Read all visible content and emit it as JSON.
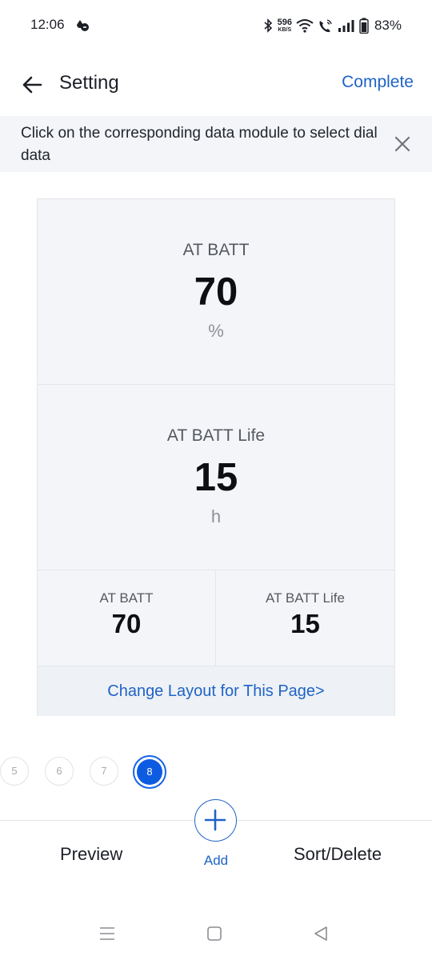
{
  "status_bar": {
    "time": "12:06",
    "net_speed_value": "596",
    "net_speed_unit": "KB/S",
    "battery_percent": "83%",
    "icons": [
      "dnd-icon",
      "bluetooth-icon",
      "wifi-icon",
      "wifi-calling-icon",
      "signal-icon",
      "battery-icon"
    ]
  },
  "header": {
    "title": "Setting",
    "complete_label": "Complete"
  },
  "hint": {
    "text": "Click on the corresponding data module to select dial data"
  },
  "dial": {
    "modules": [
      {
        "label": "AT BATT",
        "value": "70",
        "unit": "%"
      },
      {
        "label": "AT BATT Life",
        "value": "15",
        "unit": "h"
      },
      {
        "label": "AT BATT",
        "value": "70"
      },
      {
        "label": "AT BATT Life",
        "value": "15"
      }
    ],
    "change_layout_label": "Change Layout for This Page>"
  },
  "pager": {
    "pages": [
      "5",
      "6",
      "7"
    ],
    "active": "8"
  },
  "toolbar": {
    "preview_label": "Preview",
    "add_label": "Add",
    "sort_delete_label": "Sort/Delete"
  },
  "colors": {
    "accent": "#1f63c6",
    "active_page": "#0d5be0",
    "card_bg": "#f4f5f8",
    "hint_bg": "#f3f5f8"
  }
}
